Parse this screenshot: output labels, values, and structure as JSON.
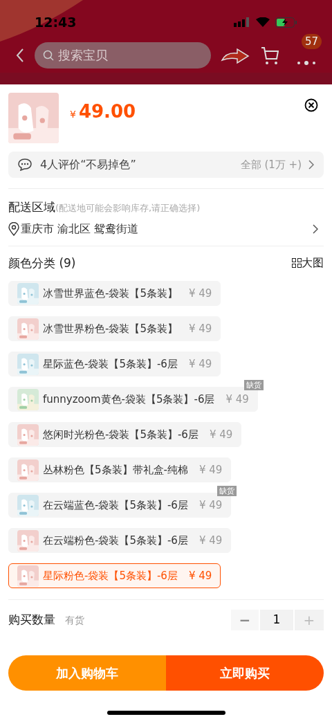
{
  "status_bar": {
    "time": "12:43"
  },
  "header": {
    "search": {
      "placeholder": "搜索宝贝"
    },
    "badge": "57"
  },
  "sheet": {
    "currency": "¥",
    "price": "49.00",
    "review": {
      "text": "4人评价“不易掉色”",
      "all": "全部 (1万 +)"
    },
    "delivery": {
      "title": "配送区域",
      "note": "(配送地可能会影响库存,请正确选择)",
      "address": "重庆市 渝北区 鸳鸯街道"
    },
    "variants_title": "颜色分类 (9)",
    "big_image": "大图",
    "variants": [
      {
        "name": "冰雪世界蓝色-袋装【5条装】",
        "price": "¥ 49",
        "selected": false
      },
      {
        "name": "冰雪世界粉色-袋装【5条装】",
        "price": "¥ 49",
        "selected": false
      },
      {
        "name": "星际蓝色-袋装【5条装】-6层",
        "price": "¥ 49",
        "selected": false
      },
      {
        "name": "funnyzoom黄色-袋装【5条装】-6层",
        "price": "¥ 49",
        "badge": "缺货",
        "selected": false
      },
      {
        "name": "悠闲时光粉色-袋装【5条装】-6层",
        "price": "¥ 49",
        "selected": false
      },
      {
        "name": "丛林粉色【5条装】带礼盒-纯棉",
        "price": "¥ 49",
        "selected": false
      },
      {
        "name": "在云端蓝色-袋装【5条装】-6层",
        "price": "¥ 49",
        "badge": "缺货",
        "selected": false
      },
      {
        "name": "在云端粉色-袋装【5条装】-6层",
        "price": "¥ 49",
        "selected": false
      },
      {
        "name": "星际粉色-袋装【5条装】-6层",
        "price": "¥ 49",
        "selected": true
      }
    ],
    "quantity": {
      "label": "购买数量",
      "stock": "有货",
      "minus": "−",
      "value": "1",
      "plus": "+"
    },
    "buttons": {
      "cart": "加入购物车",
      "buy": "立即购买"
    }
  }
}
